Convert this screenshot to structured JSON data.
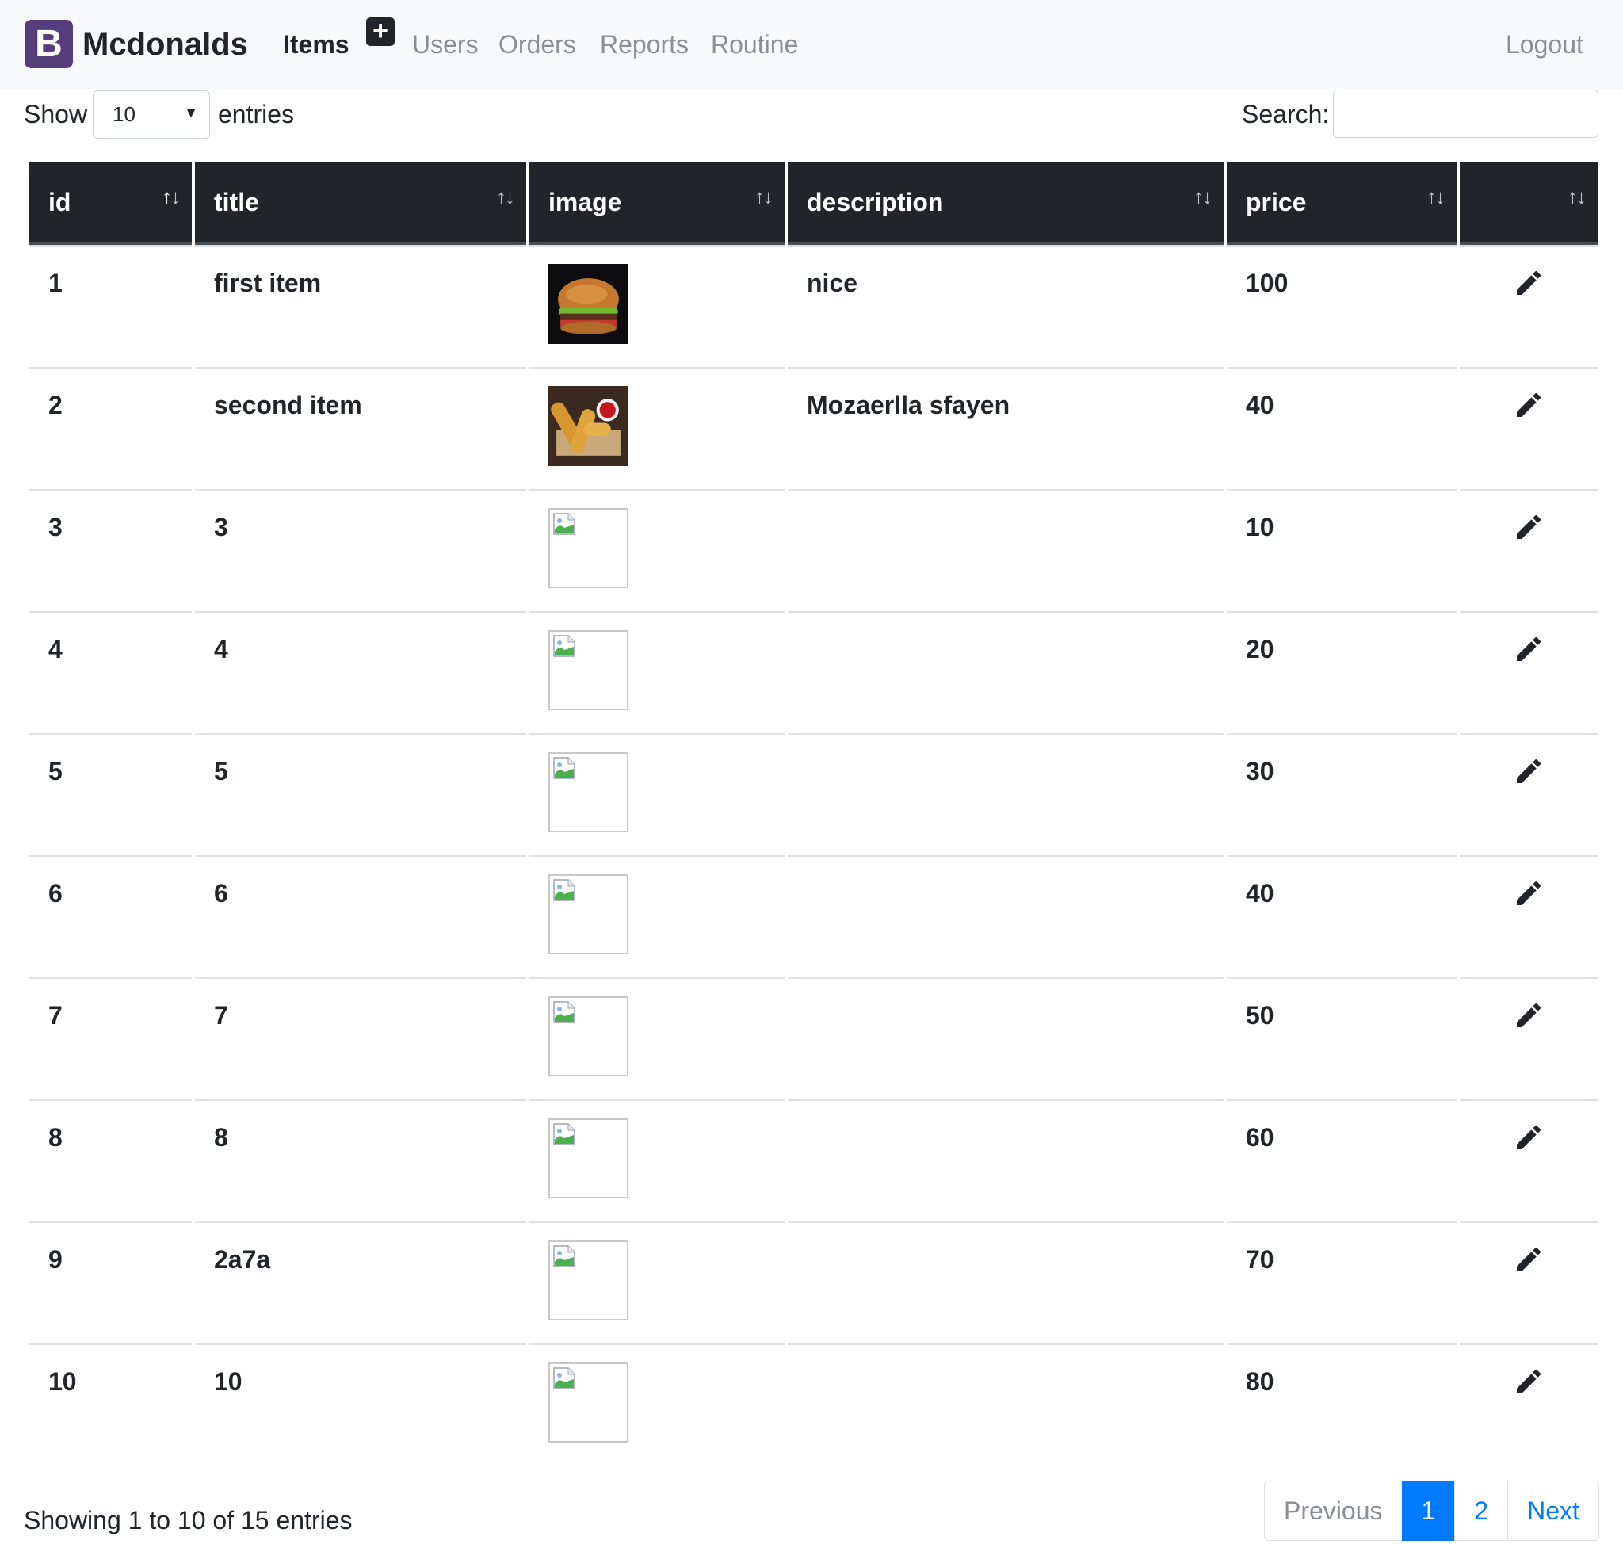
{
  "navbar": {
    "brand_logo": "B",
    "brand_name": "Mcdonalds",
    "links": [
      {
        "label": "Items",
        "active": true
      },
      {
        "label": "Users"
      },
      {
        "label": "Orders"
      },
      {
        "label": "Reports"
      },
      {
        "label": "Routine"
      }
    ],
    "add_icon": "plus-icon",
    "logout": "Logout"
  },
  "controls": {
    "show_label": "Show",
    "length_value": "10",
    "entries_label": "entries",
    "search_label": "Search:",
    "search_value": ""
  },
  "table": {
    "columns": [
      "id",
      "title",
      "image",
      "description",
      "price",
      ""
    ],
    "rows": [
      {
        "id": "1",
        "title": "first item",
        "image": "burger-photo",
        "description": "nice",
        "price": "100"
      },
      {
        "id": "2",
        "title": "second item",
        "image": "mozzarella-sticks-photo",
        "description": "Mozaerlla sfayen",
        "price": "40"
      },
      {
        "id": "3",
        "title": "3",
        "image": "broken-image-icon",
        "description": "",
        "price": "10"
      },
      {
        "id": "4",
        "title": "4",
        "image": "broken-image-icon",
        "description": "",
        "price": "20"
      },
      {
        "id": "5",
        "title": "5",
        "image": "broken-image-icon",
        "description": "",
        "price": "30"
      },
      {
        "id": "6",
        "title": "6",
        "image": "broken-image-icon",
        "description": "",
        "price": "40"
      },
      {
        "id": "7",
        "title": "7",
        "image": "broken-image-icon",
        "description": "",
        "price": "50"
      },
      {
        "id": "8",
        "title": "8",
        "image": "broken-image-icon",
        "description": "",
        "price": "60"
      },
      {
        "id": "9",
        "title": "2a7a",
        "image": "broken-image-icon",
        "description": "",
        "price": "70"
      },
      {
        "id": "10",
        "title": "10",
        "image": "broken-image-icon",
        "description": "",
        "price": "80"
      }
    ]
  },
  "footer": {
    "info": "Showing 1 to 10 of 15 entries",
    "pagination": {
      "previous": "Previous",
      "pages": [
        "1",
        "2"
      ],
      "active_page": "1",
      "next": "Next"
    }
  },
  "colors": {
    "navbar_bg": "#f8f9fa",
    "header_bg": "#212529",
    "brand_logo_bg": "#563d7c",
    "primary": "#007bff"
  }
}
